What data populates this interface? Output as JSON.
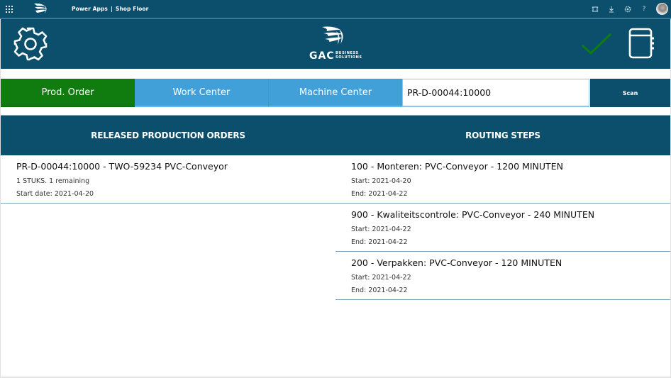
{
  "topbar": {
    "product": "Power Apps",
    "separator": "|",
    "app_name": "Shop Floor",
    "icons": [
      "waffle-icon",
      "power-apps-logo",
      "fit-to-screen-icon",
      "download-icon",
      "settings-icon",
      "help-icon",
      "user-avatar"
    ],
    "help_glyph": "?"
  },
  "header": {
    "settings_icon": "gear-icon",
    "logo": {
      "main": "GAC",
      "line1": "BUSINESS",
      "line2": "SOLUTIONS"
    },
    "confirm_icon": "checkmark-icon",
    "notebook_icon": "notebook-icon",
    "colors": {
      "background": "#0b4f6c",
      "check": "#107c10"
    }
  },
  "tabs": [
    {
      "label": "Prod. Order",
      "active": true,
      "color": "#107c10"
    },
    {
      "label": "Work Center",
      "active": false,
      "color": "#42a0d9"
    },
    {
      "label": "Machine Center",
      "active": false,
      "color": "#42a0d9"
    }
  ],
  "search": {
    "value": "PR-D-00044:10000",
    "placeholder": ""
  },
  "scan_button": {
    "label": "Scan"
  },
  "released_orders": {
    "header": "RELEASED PRODUCTION ORDERS",
    "items": [
      {
        "title": "PR-D-00044:10000 - TWO-59234 PVC-Conveyor",
        "quantity": "1 STUKS. 1 remaining",
        "start_date": "Start date: 2021-04-20"
      }
    ]
  },
  "routing_steps": {
    "header": "ROUTING STEPS",
    "items": [
      {
        "title": "100 - Monteren: PVC-Conveyor - 1200 MINUTEN",
        "start": "Start: 2021-04-20",
        "end": "End: 2021-04-22"
      },
      {
        "title": "900 - Kwaliteitscontrole: PVC-Conveyor - 240 MINUTEN",
        "start": "Start: 2021-04-22",
        "end": "End: 2021-04-22"
      },
      {
        "title": "200 - Verpakken: PVC-Conveyor - 120 MINUTEN",
        "start": "Start: 2021-04-22",
        "end": "End: 2021-04-22"
      }
    ]
  }
}
